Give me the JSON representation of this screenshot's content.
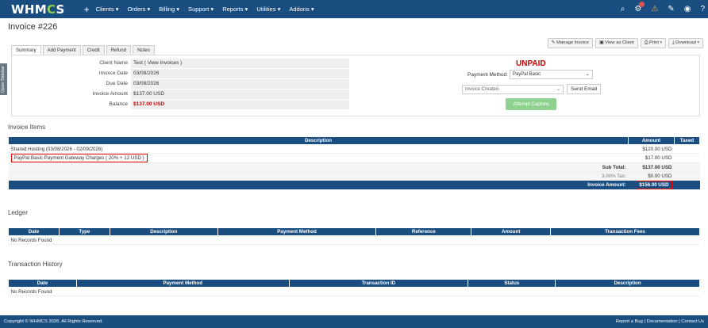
{
  "brand": {
    "logo_pre": "WHM",
    "logo_o": "C",
    "logo_post": "S"
  },
  "nav": [
    "Clients ▾",
    "Orders ▾",
    "Billing ▾",
    "Support ▾",
    "Reports ▾",
    "Utilities ▾",
    "Addons ▾"
  ],
  "page_title": "Invoice #226",
  "sidebar_toggle": "Open Sidebar",
  "actions": {
    "manage": "✎ Manage Invoice",
    "view_client": "▣ View as Client",
    "print": "⎙ Print ▾",
    "download": "⤓ Download ▾"
  },
  "tabs": [
    "Summary",
    "Add Payment",
    "Credit",
    "Refund",
    "Notes"
  ],
  "summary": [
    {
      "label": "Client Name",
      "value": "Test ( View Invoices )"
    },
    {
      "label": "Invoice Date",
      "value": "03/08/2026"
    },
    {
      "label": "Due Date",
      "value": "03/08/2026"
    },
    {
      "label": "Invoice Amount",
      "value": "$137.00 USD"
    },
    {
      "label": "Balance",
      "value": "$137.00 USD"
    }
  ],
  "status": "UNPAID",
  "payment": {
    "label": "Payment Method:",
    "value": "PayPal Basic"
  },
  "email": {
    "template": "Invoice Created",
    "send_label": "Send Email"
  },
  "capture_label": "Attempt Capture",
  "invoice_items": {
    "title": "Invoice Items",
    "headers": [
      "Description",
      "Amount",
      "Taxed"
    ],
    "rows": [
      {
        "desc": "Shared Hosting (03/08/2026 - 02/09/2026)",
        "amount": "$120.00 USD"
      },
      {
        "desc": "PayPal Basic Payment Gateway Charges ( 20% + 12 USD )",
        "amount": "$17.00 USD"
      }
    ],
    "subtotal": {
      "label": "Sub Total:",
      "value": "$137.00 USD"
    },
    "tax": {
      "label": "3.00% Tax:",
      "value": "$0.00 USD"
    },
    "total": {
      "label": "Invoice Amount:",
      "value": "$156.00 USD"
    }
  },
  "ledger": {
    "title": "Ledger",
    "headers": [
      "Date",
      "Type",
      "Description",
      "Payment Method",
      "Reference",
      "Amount",
      "Transaction Fees"
    ],
    "empty": "No Records Found"
  },
  "transactions": {
    "title": "Transaction History",
    "headers": [
      "Date",
      "Payment Method",
      "Transaction ID",
      "Status",
      "Description"
    ],
    "empty": "No Records Found"
  },
  "footer": {
    "copyright": "Copyright © WHMCS 2026. All Rights Reserved.",
    "links": "Report a Bug | Documentation | Contact Us"
  }
}
